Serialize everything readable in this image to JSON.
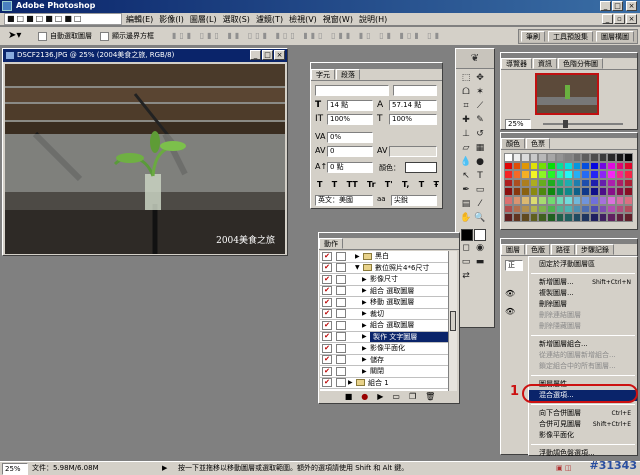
{
  "app": {
    "title": "Adobe Photoshop"
  },
  "menubar": {
    "items": [
      {
        "label": "編輯(E)"
      },
      {
        "label": "影像(I)"
      },
      {
        "label": "圖層(L)"
      },
      {
        "label": "選取(S)"
      },
      {
        "label": "濾鏡(T)"
      },
      {
        "label": "檢視(V)"
      },
      {
        "label": "視窗(W)"
      },
      {
        "label": "說明(H)"
      }
    ]
  },
  "options": {
    "auto_select": "自動選取圖層",
    "show_bounds": "顯示邊界方框",
    "right_tabs": [
      "筆刷",
      "工具預設集",
      "圖層構圖"
    ]
  },
  "document": {
    "title": "DSCF2136.JPG @ 25% (2004美食之旅, RGB/8)",
    "caption": "2004美食之旅"
  },
  "char_panel": {
    "tabs": [
      "字元",
      "段落"
    ],
    "font_size": "14 點",
    "leading": "57.14 點",
    "scale_v": "100%",
    "scale_h": "100%",
    "tracking": "0%",
    "kerning": "0",
    "baseline": "0 點",
    "color_label": "顏色：",
    "style_glyphs": [
      "T",
      "T",
      "TT",
      "Tr",
      "T'",
      "T,",
      "T",
      "Ŧ"
    ],
    "language": "英文：美國",
    "aa_label": "aa",
    "aa_value": "尖銳"
  },
  "actions_panel": {
    "tab": "動作",
    "rows": [
      {
        "label": "黑白",
        "indent": 1,
        "check": true
      },
      {
        "label": "數位照片4*6尺寸",
        "indent": 1,
        "check": true,
        "expanded": true
      },
      {
        "label": "影像尺寸",
        "indent": 2,
        "check": true
      },
      {
        "label": "組合 選取圖層",
        "indent": 2,
        "check": true
      },
      {
        "label": "移動 選取圖層",
        "indent": 2,
        "check": true
      },
      {
        "label": "裁切",
        "indent": 2,
        "check": true
      },
      {
        "label": "組合 選取圖層",
        "indent": 2,
        "check": true
      },
      {
        "label": "製作 文字圖層",
        "indent": 2,
        "check": true,
        "selected": true
      },
      {
        "label": "影像平面化",
        "indent": 2,
        "check": true
      },
      {
        "label": "儲存",
        "indent": 2,
        "check": true
      },
      {
        "label": "關閉",
        "indent": 2,
        "check": true
      },
      {
        "label": "組合 1",
        "indent": 0,
        "check": true
      }
    ]
  },
  "navigator_panel": {
    "tabs": [
      "導覽器",
      "資訊",
      "色階分佈圖"
    ],
    "zoom": "25%"
  },
  "color_panel": {
    "tabs": [
      "顏色",
      "色票"
    ]
  },
  "layers_panel": {
    "tabs": [
      "圖層",
      "色版",
      "路徑",
      "步驟記錄"
    ],
    "blend": "正"
  },
  "layers_menu": {
    "items": [
      {
        "label": "固定於浮動圖層區",
        "disabled": false
      },
      {
        "sep": true
      },
      {
        "label": "新增圖層...",
        "shortcut": "Shift+Ctrl+N",
        "disabled": false
      },
      {
        "label": "複製圖層...",
        "disabled": false
      },
      {
        "label": "刪除圖層",
        "disabled": false
      },
      {
        "label": "刪除連結圖層",
        "disabled": true
      },
      {
        "label": "刪除隱藏圖層",
        "disabled": true
      },
      {
        "sep": true
      },
      {
        "label": "新增圖層組合...",
        "disabled": false
      },
      {
        "label": "從連結的圖層新增組合...",
        "disabled": true
      },
      {
        "label": "鎖定組合中的所有圖層...",
        "disabled": true
      },
      {
        "sep": true
      },
      {
        "label": "圖層屬性...",
        "disabled": false
      },
      {
        "label": "混合選項...",
        "disabled": false,
        "highlight": true
      },
      {
        "sep": true
      },
      {
        "label": "向下合併圖層",
        "shortcut": "Ctrl+E",
        "disabled": false
      },
      {
        "label": "合併可見圖層",
        "shortcut": "Shift+Ctrl+E",
        "disabled": false
      },
      {
        "label": "影像平面化",
        "disabled": false
      },
      {
        "sep": true
      },
      {
        "label": "浮動調色盤選項...",
        "disabled": false
      }
    ]
  },
  "annotation": {
    "number": "1"
  },
  "statusbar": {
    "zoom": "25%",
    "doc_size": "文件：5.98M/6.08M",
    "hint": "按一下並拖移以移動圖層或選取範圍。額外的選項請使用 Shift 和 Alt 鍵。",
    "watermark": "#31343"
  },
  "colors": {
    "title_active": "#0a246a",
    "chrome": "#d4d0c8",
    "selected": "#0a246a",
    "circle": "#cc1111"
  }
}
